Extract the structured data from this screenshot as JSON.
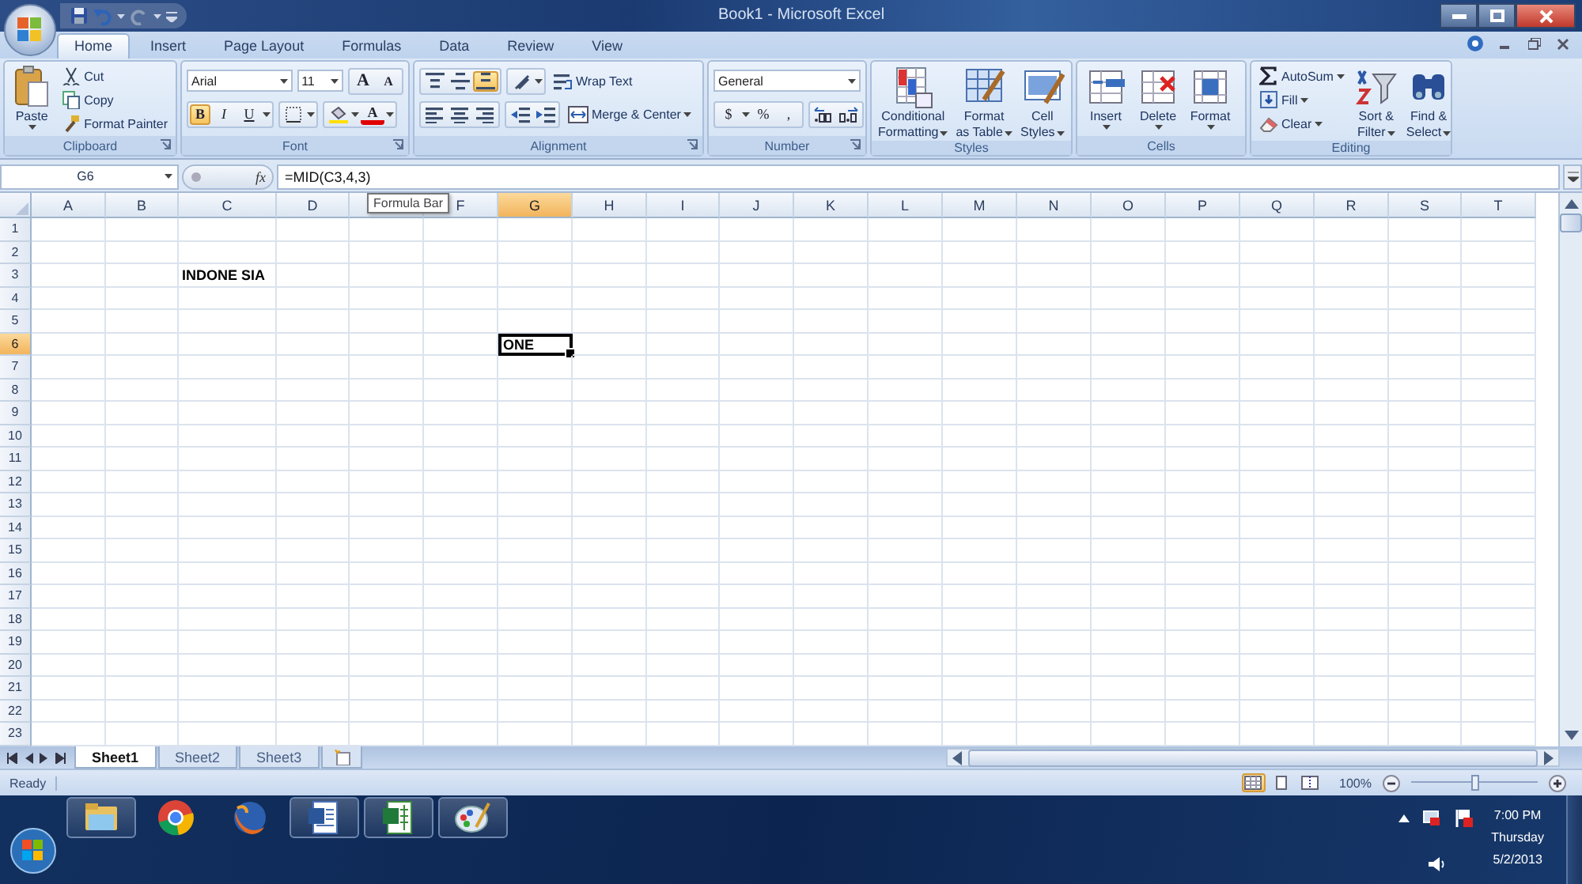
{
  "window": {
    "title": "Book1 - Microsoft Excel"
  },
  "tabs": [
    {
      "label": "Home",
      "selected": true
    },
    {
      "label": "Insert",
      "selected": false
    },
    {
      "label": "Page Layout",
      "selected": false
    },
    {
      "label": "Formulas",
      "selected": false
    },
    {
      "label": "Data",
      "selected": false
    },
    {
      "label": "Review",
      "selected": false
    },
    {
      "label": "View",
      "selected": false
    }
  ],
  "ribbon": [
    {
      "kind": "clipboard",
      "name": "Clipboard",
      "paste": "Paste",
      "items": [
        {
          "kind": "cut",
          "label": "Cut"
        },
        {
          "kind": "copy",
          "label": "Copy"
        },
        {
          "kind": "painter",
          "label": "Format Painter"
        }
      ]
    },
    {
      "kind": "font",
      "name": "Font",
      "font_name": "Arial",
      "font_size": "11",
      "grow": "A",
      "shrink": "A",
      "styles": [
        {
          "label": "B",
          "selected": true
        },
        {
          "label": "I",
          "selected": false
        },
        {
          "label": "U",
          "selected": false
        }
      ],
      "font_color": {
        "label": "A",
        "color": "#e00000"
      }
    },
    {
      "kind": "alignment",
      "name": "Alignment",
      "vertical": [
        {
          "selected": false
        },
        {
          "selected": false
        },
        {
          "selected": true
        }
      ],
      "wrap": "Wrap Text",
      "merge": "Merge & Center"
    },
    {
      "kind": "number",
      "name": "Number",
      "format": "General",
      "symbols": [
        "$",
        "%",
        ","
      ]
    },
    {
      "kind": "large",
      "name": "Styles",
      "buttons": [
        {
          "kind": "conditional",
          "lines": [
            "Conditional",
            "Formatting"
          ],
          "dropdown": true
        },
        {
          "kind": "table",
          "lines": [
            "Format",
            "as Table"
          ],
          "dropdown": true
        },
        {
          "kind": "styles",
          "lines": [
            "Cell",
            "Styles"
          ],
          "dropdown": true
        }
      ]
    },
    {
      "kind": "large",
      "name": "Cells",
      "buttons": [
        {
          "kind": "insert",
          "lines": [
            "Insert"
          ],
          "dropdown": true
        },
        {
          "kind": "delete",
          "lines": [
            "Delete"
          ],
          "dropdown": true
        },
        {
          "kind": "format",
          "lines": [
            "Format"
          ],
          "dropdown": true
        }
      ]
    },
    {
      "kind": "editing",
      "name": "Editing",
      "items": [
        {
          "kind": "sum",
          "label": "AutoSum"
        },
        {
          "kind": "fill",
          "label": "Fill"
        },
        {
          "kind": "clear",
          "label": "Clear"
        }
      ],
      "buttons": [
        {
          "kind": "sort",
          "lines": [
            "Sort &",
            "Filter"
          ],
          "dropdown": true
        },
        {
          "kind": "find",
          "lines": [
            "Find &",
            "Select"
          ],
          "dropdown": true
        }
      ]
    }
  ],
  "formula_bar": {
    "name_box": "G6",
    "fx": "fx",
    "formula": "=MID(C3,4,3)",
    "tooltip": "Formula Bar"
  },
  "sheet": {
    "columns": [
      {
        "label": "A",
        "selected": false
      },
      {
        "label": "B",
        "selected": false
      },
      {
        "label": "C",
        "selected": false
      },
      {
        "label": "D",
        "selected": false
      },
      {
        "selected": false
      },
      {
        "label": "F",
        "selected": false
      },
      {
        "label": "G",
        "selected": true
      },
      {
        "label": "H",
        "selected": false
      },
      {
        "label": "I",
        "selected": false
      },
      {
        "label": "J",
        "selected": false
      },
      {
        "label": "K",
        "selected": false
      },
      {
        "label": "L",
        "selected": false
      },
      {
        "label": "M",
        "selected": false
      },
      {
        "label": "N",
        "selected": false
      },
      {
        "label": "O",
        "selected": false
      },
      {
        "label": "P",
        "selected": false
      },
      {
        "label": "Q",
        "selected": false
      },
      {
        "label": "R",
        "selected": false
      },
      {
        "label": "S",
        "selected": false
      },
      {
        "label": "T",
        "selected": false
      }
    ],
    "rows": [
      {
        "label": "1",
        "selected": false
      },
      {
        "label": "2",
        "selected": false
      },
      {
        "label": "3",
        "selected": false,
        "cells": [
          {
            "kind": "empty"
          },
          {
            "kind": "empty"
          },
          {
            "kind": "text",
            "text": "INDONE SIA",
            "selected": false
          }
        ]
      },
      {
        "label": "4",
        "selected": false
      },
      {
        "label": "5",
        "selected": false
      },
      {
        "label": "6",
        "selected": true,
        "cells": [
          {
            "kind": "empty"
          },
          {
            "kind": "empty"
          },
          {
            "kind": "empty"
          },
          {
            "kind": "empty"
          },
          {
            "kind": "empty"
          },
          {
            "kind": "empty"
          },
          {
            "kind": "text",
            "text": "ONE",
            "selected": true
          }
        ]
      },
      {
        "label": "7",
        "selected": false
      },
      {
        "label": "8",
        "selected": false
      },
      {
        "label": "9",
        "selected": false
      },
      {
        "label": "10",
        "selected": false
      },
      {
        "label": "11",
        "selected": false
      },
      {
        "label": "12",
        "selected": false
      },
      {
        "label": "13",
        "selected": false
      },
      {
        "label": "14",
        "selected": false
      },
      {
        "label": "15",
        "selected": false
      },
      {
        "label": "16",
        "selected": false
      },
      {
        "label": "17",
        "selected": false
      },
      {
        "label": "18",
        "selected": false
      },
      {
        "label": "19",
        "selected": false
      },
      {
        "label": "20",
        "selected": false
      },
      {
        "label": "21",
        "selected": false
      },
      {
        "label": "22",
        "selected": false
      },
      {
        "label": "23",
        "selected": false
      }
    ]
  },
  "sheet_tabs": [
    {
      "label": "Sheet1",
      "selected": true
    },
    {
      "label": "Sheet2",
      "selected": false
    },
    {
      "label": "Sheet3",
      "selected": false
    }
  ],
  "status_bar": {
    "text": "Ready",
    "views": [
      {
        "selected": true
      },
      {
        "selected": false
      },
      {
        "selected": false
      }
    ],
    "zoom": "100%",
    "zoom_slider": {
      "level": 0.5
    }
  },
  "taskbar": {
    "apps": [
      {
        "kind": "folder",
        "running": true
      },
      {
        "kind": "wheel",
        "running": false
      },
      {
        "kind": "fox",
        "running": false
      },
      {
        "kind": "document",
        "running": true
      },
      {
        "kind": "sheet",
        "running": true
      },
      {
        "kind": "palette",
        "running": true
      }
    ],
    "clock": [
      "7:00 PM",
      "Thursday",
      "5/2/2013"
    ]
  }
}
